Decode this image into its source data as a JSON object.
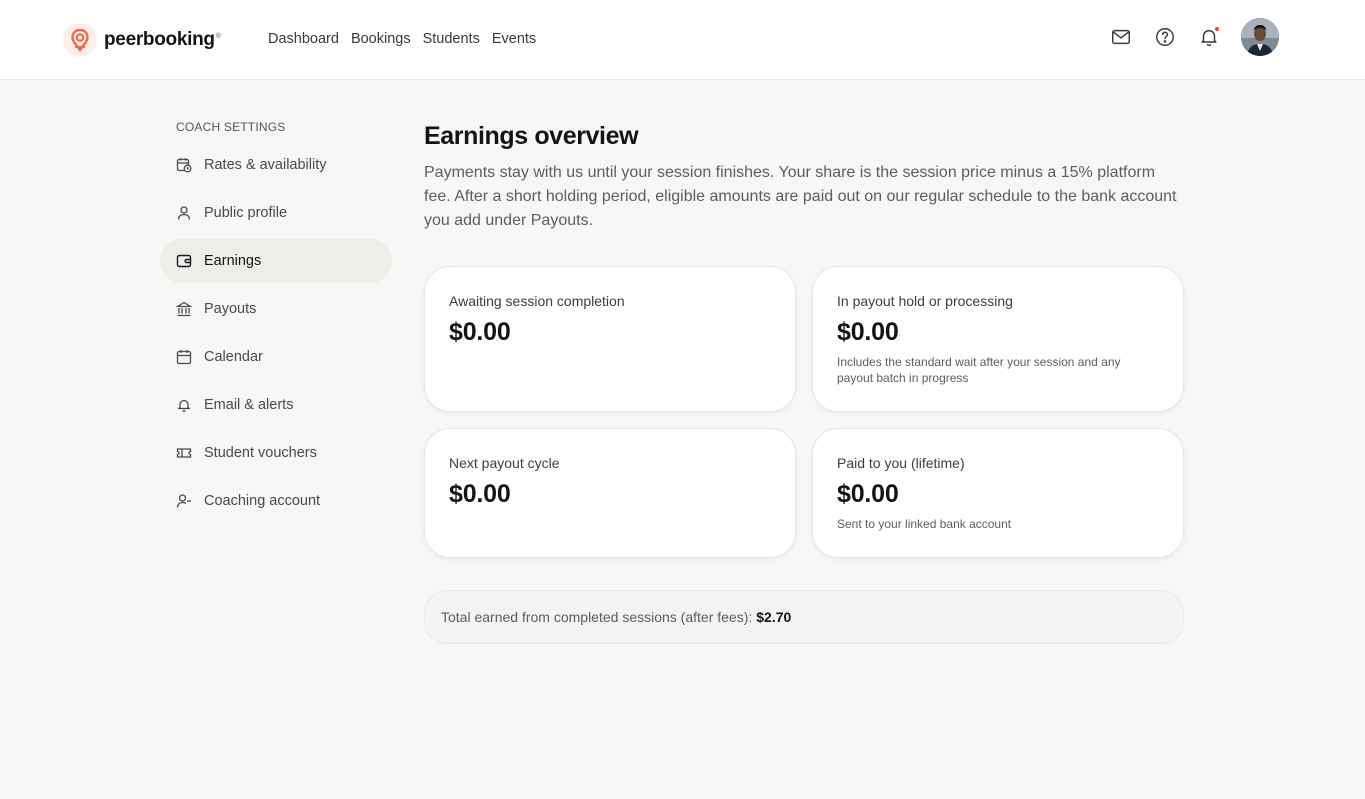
{
  "brand": {
    "name": "peerbooking",
    "reg": "®",
    "accent": "#ef6a4c"
  },
  "nav": {
    "items": [
      "Dashboard",
      "Bookings",
      "Students",
      "Events"
    ]
  },
  "header_icons": [
    "mail-icon",
    "help-icon",
    "bell-icon"
  ],
  "sidebar": {
    "heading": "COACH SETTINGS",
    "items": [
      {
        "label": "Rates & availability",
        "icon": "calendar-clock-icon"
      },
      {
        "label": "Public profile",
        "icon": "user-icon"
      },
      {
        "label": "Earnings",
        "icon": "wallet-icon",
        "active": true
      },
      {
        "label": "Payouts",
        "icon": "bank-icon"
      },
      {
        "label": "Calendar",
        "icon": "calendar-icon"
      },
      {
        "label": "Email & alerts",
        "icon": "bell-icon"
      },
      {
        "label": "Student vouchers",
        "icon": "ticket-icon"
      },
      {
        "label": "Coaching account",
        "icon": "user-minus-icon"
      }
    ]
  },
  "main": {
    "title": "Earnings overview",
    "intro": "Payments stay with us until your session finishes. Your share is the session price minus a 15% platform fee. After a short holding period, eligible amounts are paid out on our regular schedule to the bank account you add under Payouts.",
    "cards": [
      {
        "label": "Awaiting session completion",
        "value": "$0.00",
        "note": ""
      },
      {
        "label": "In payout hold or processing",
        "value": "$0.00",
        "note": "Includes the standard wait after your session and any payout batch in progress"
      },
      {
        "label": "Next payout cycle",
        "value": "$0.00",
        "note": ""
      },
      {
        "label": "Paid to you (lifetime)",
        "value": "$0.00",
        "note": "Sent to your linked bank account"
      }
    ],
    "total": {
      "label": "Total earned from completed sessions (after fees):",
      "amount": "$2.70"
    }
  }
}
